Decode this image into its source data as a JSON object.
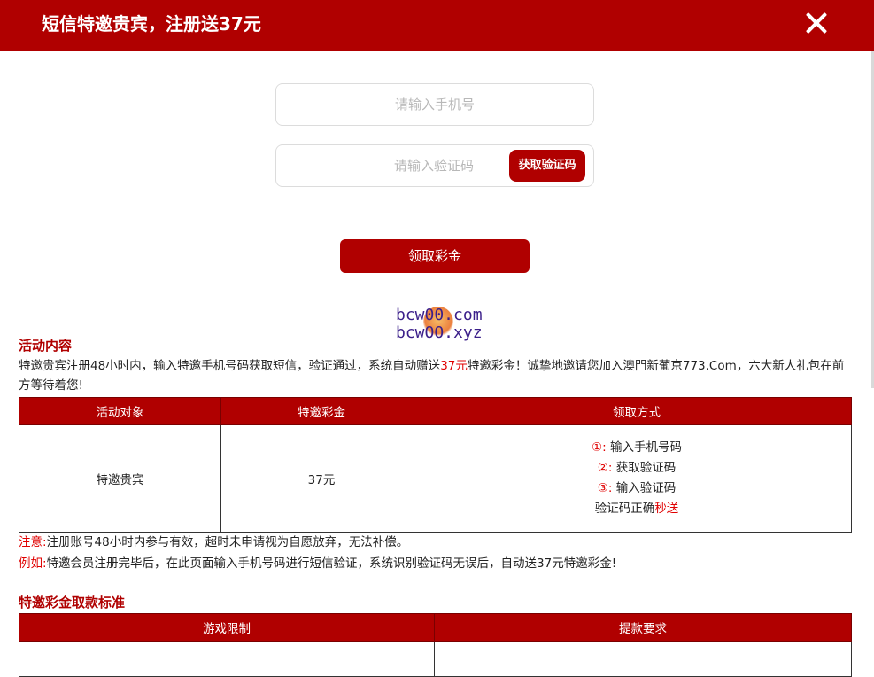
{
  "header": {
    "title": "短信特邀贵宾，注册送37元"
  },
  "form": {
    "phone_placeholder": "请输入手机号",
    "code_placeholder": "请输入验证码",
    "get_code_label": "获取验证码",
    "claim_label": "领取彩金"
  },
  "watermark": {
    "line1": "bcw00.com",
    "line2": "bcwOO.xyz"
  },
  "activity": {
    "heading": "活动内容",
    "intro_part1": "特邀贵宾注册48小时内，输入特邀手机号码获取短信，验证通过，系统自动赠送",
    "intro_amount": "37元",
    "intro_part2": "特邀彩金！诚挚地邀请您加入澳門新葡京773.Com，六大新人礼包在前方等待着您!",
    "table": {
      "headers": [
        "活动对象",
        "特邀彩金",
        "领取方式"
      ],
      "target": "特邀贵宾",
      "bonus": "37元",
      "steps": [
        {
          "num": "①",
          "text": "输入手机号码"
        },
        {
          "num": "②",
          "text": "获取验证码"
        },
        {
          "num": "③",
          "text": "输入验证码"
        }
      ],
      "final_part1": "验证码正确",
      "final_part2": "秒送"
    },
    "notice_label": "注意:",
    "notice_text": "注册账号48小时内参与有效，超时未申请视为自愿放弃，无法补偿。",
    "example_label": "例如:",
    "example_text": "特邀会员注册完毕后，在此页面输入手机号码进行短信验证，系统识别验证码无误后，自动送37元特邀彩金!"
  },
  "withdraw": {
    "heading": "特邀彩金取款标准",
    "headers": [
      "游戏限制",
      "提款要求"
    ]
  },
  "colors": {
    "brand": "#b00000",
    "highlight": "#e00000"
  }
}
